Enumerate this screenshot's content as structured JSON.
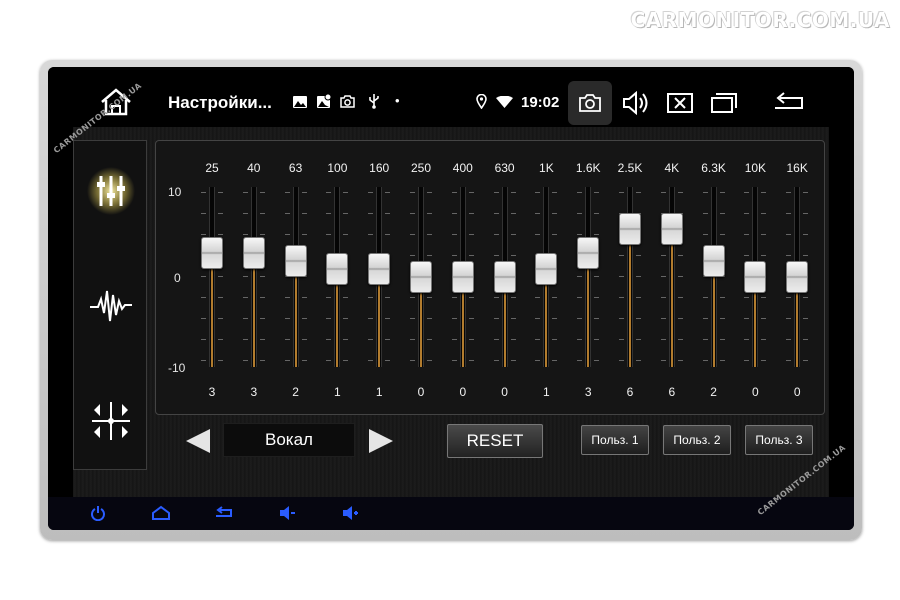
{
  "watermark": "CARMONITOR.COM.UA",
  "watermark_small": "CARMONITOR.COM.UA",
  "status_bar": {
    "title": "Настройки...",
    "time": "19:02",
    "dot": "•"
  },
  "equalizer": {
    "db_labels": [
      "10",
      "0",
      "-10"
    ],
    "db_range": [
      -10,
      10
    ],
    "bands": [
      {
        "freq": "25",
        "value": 3
      },
      {
        "freq": "40",
        "value": 3
      },
      {
        "freq": "63",
        "value": 2
      },
      {
        "freq": "100",
        "value": 1
      },
      {
        "freq": "160",
        "value": 1
      },
      {
        "freq": "250",
        "value": 0
      },
      {
        "freq": "400",
        "value": 0
      },
      {
        "freq": "630",
        "value": 0
      },
      {
        "freq": "1K",
        "value": 1
      },
      {
        "freq": "1.6K",
        "value": 3
      },
      {
        "freq": "2.5K",
        "value": 6
      },
      {
        "freq": "4K",
        "value": 6
      },
      {
        "freq": "6.3K",
        "value": 2
      },
      {
        "freq": "10K",
        "value": 0
      },
      {
        "freq": "16K",
        "value": 0
      }
    ]
  },
  "controls": {
    "preset": "Вокал",
    "reset_label": "RESET",
    "user_presets": [
      "Польз. 1",
      "Польз. 2",
      "Польз. 3"
    ]
  },
  "colors": {
    "accent_glow": "#f3e58a",
    "hw_blue": "#1f4dff",
    "slider_fill": "#d99a40"
  }
}
